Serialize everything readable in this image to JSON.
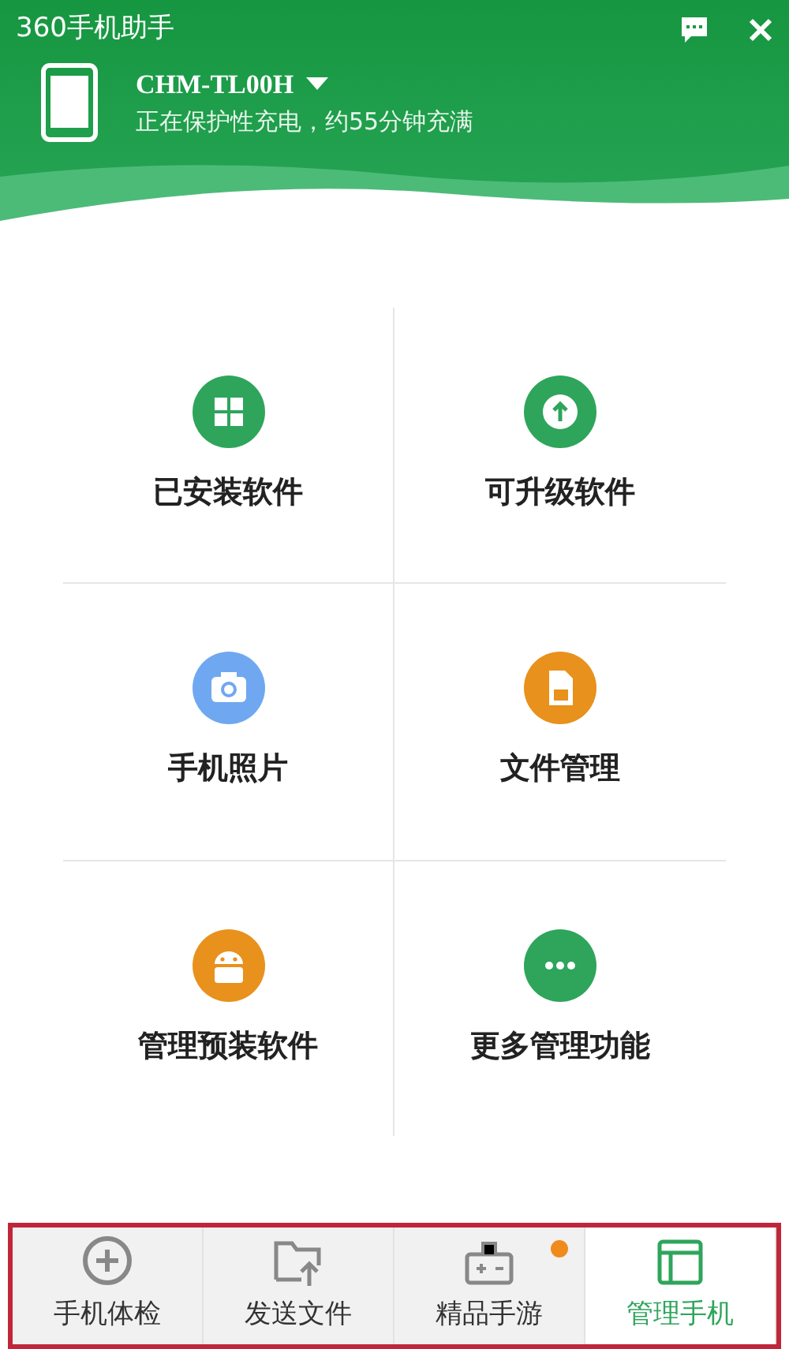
{
  "window": {
    "title": "360手机助手"
  },
  "device": {
    "name": "CHM-TL00H",
    "status": "正在保护性充电，约55分钟充满"
  },
  "tiles": [
    {
      "label": "已安装软件",
      "kind": "apps",
      "color": "#2ea55b"
    },
    {
      "label": "可升级软件",
      "kind": "upgrade",
      "color": "#2ea55b"
    },
    {
      "label": "手机照片",
      "kind": "camera",
      "color": "#6fa8f0"
    },
    {
      "label": "文件管理",
      "kind": "sdcard",
      "color": "#e8911c"
    },
    {
      "label": "管理预装软件",
      "kind": "android",
      "color": "#e8911c"
    },
    {
      "label": "更多管理功能",
      "kind": "more",
      "color": "#2ea55b"
    }
  ],
  "tabs": [
    {
      "label": "手机体检",
      "kind": "checkup",
      "selected": false,
      "badge": false
    },
    {
      "label": "发送文件",
      "kind": "send",
      "selected": false,
      "badge": false
    },
    {
      "label": "精品手游",
      "kind": "game",
      "selected": false,
      "badge": true
    },
    {
      "label": "管理手机",
      "kind": "manage",
      "selected": true,
      "badge": false
    }
  ]
}
